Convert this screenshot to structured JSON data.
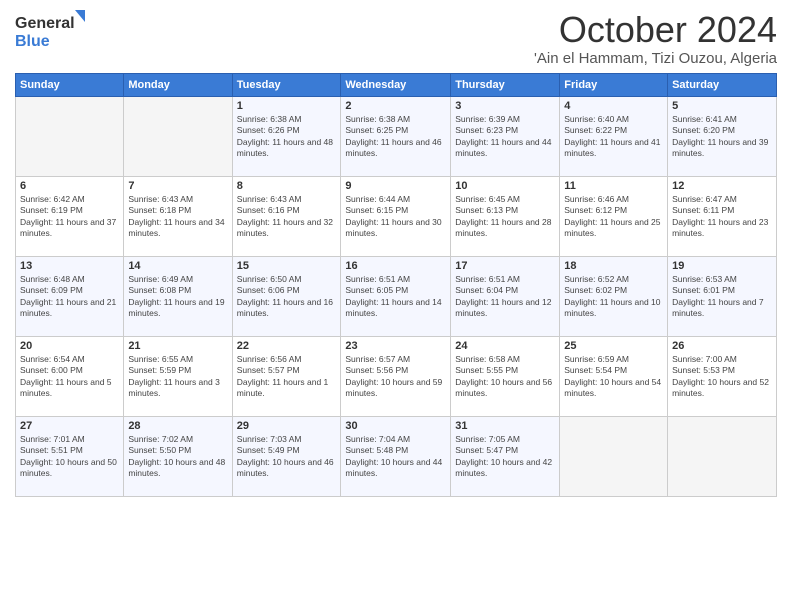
{
  "header": {
    "logo_general": "General",
    "logo_blue": "Blue",
    "title": "October 2024",
    "location": "'Ain el Hammam, Tizi Ouzou, Algeria"
  },
  "weekdays": [
    "Sunday",
    "Monday",
    "Tuesday",
    "Wednesday",
    "Thursday",
    "Friday",
    "Saturday"
  ],
  "weeks": [
    [
      {
        "day": "",
        "sunrise": "",
        "sunset": "",
        "daylight": ""
      },
      {
        "day": "",
        "sunrise": "",
        "sunset": "",
        "daylight": ""
      },
      {
        "day": "1",
        "sunrise": "Sunrise: 6:38 AM",
        "sunset": "Sunset: 6:26 PM",
        "daylight": "Daylight: 11 hours and 48 minutes."
      },
      {
        "day": "2",
        "sunrise": "Sunrise: 6:38 AM",
        "sunset": "Sunset: 6:25 PM",
        "daylight": "Daylight: 11 hours and 46 minutes."
      },
      {
        "day": "3",
        "sunrise": "Sunrise: 6:39 AM",
        "sunset": "Sunset: 6:23 PM",
        "daylight": "Daylight: 11 hours and 44 minutes."
      },
      {
        "day": "4",
        "sunrise": "Sunrise: 6:40 AM",
        "sunset": "Sunset: 6:22 PM",
        "daylight": "Daylight: 11 hours and 41 minutes."
      },
      {
        "day": "5",
        "sunrise": "Sunrise: 6:41 AM",
        "sunset": "Sunset: 6:20 PM",
        "daylight": "Daylight: 11 hours and 39 minutes."
      }
    ],
    [
      {
        "day": "6",
        "sunrise": "Sunrise: 6:42 AM",
        "sunset": "Sunset: 6:19 PM",
        "daylight": "Daylight: 11 hours and 37 minutes."
      },
      {
        "day": "7",
        "sunrise": "Sunrise: 6:43 AM",
        "sunset": "Sunset: 6:18 PM",
        "daylight": "Daylight: 11 hours and 34 minutes."
      },
      {
        "day": "8",
        "sunrise": "Sunrise: 6:43 AM",
        "sunset": "Sunset: 6:16 PM",
        "daylight": "Daylight: 11 hours and 32 minutes."
      },
      {
        "day": "9",
        "sunrise": "Sunrise: 6:44 AM",
        "sunset": "Sunset: 6:15 PM",
        "daylight": "Daylight: 11 hours and 30 minutes."
      },
      {
        "day": "10",
        "sunrise": "Sunrise: 6:45 AM",
        "sunset": "Sunset: 6:13 PM",
        "daylight": "Daylight: 11 hours and 28 minutes."
      },
      {
        "day": "11",
        "sunrise": "Sunrise: 6:46 AM",
        "sunset": "Sunset: 6:12 PM",
        "daylight": "Daylight: 11 hours and 25 minutes."
      },
      {
        "day": "12",
        "sunrise": "Sunrise: 6:47 AM",
        "sunset": "Sunset: 6:11 PM",
        "daylight": "Daylight: 11 hours and 23 minutes."
      }
    ],
    [
      {
        "day": "13",
        "sunrise": "Sunrise: 6:48 AM",
        "sunset": "Sunset: 6:09 PM",
        "daylight": "Daylight: 11 hours and 21 minutes."
      },
      {
        "day": "14",
        "sunrise": "Sunrise: 6:49 AM",
        "sunset": "Sunset: 6:08 PM",
        "daylight": "Daylight: 11 hours and 19 minutes."
      },
      {
        "day": "15",
        "sunrise": "Sunrise: 6:50 AM",
        "sunset": "Sunset: 6:06 PM",
        "daylight": "Daylight: 11 hours and 16 minutes."
      },
      {
        "day": "16",
        "sunrise": "Sunrise: 6:51 AM",
        "sunset": "Sunset: 6:05 PM",
        "daylight": "Daylight: 11 hours and 14 minutes."
      },
      {
        "day": "17",
        "sunrise": "Sunrise: 6:51 AM",
        "sunset": "Sunset: 6:04 PM",
        "daylight": "Daylight: 11 hours and 12 minutes."
      },
      {
        "day": "18",
        "sunrise": "Sunrise: 6:52 AM",
        "sunset": "Sunset: 6:02 PM",
        "daylight": "Daylight: 11 hours and 10 minutes."
      },
      {
        "day": "19",
        "sunrise": "Sunrise: 6:53 AM",
        "sunset": "Sunset: 6:01 PM",
        "daylight": "Daylight: 11 hours and 7 minutes."
      }
    ],
    [
      {
        "day": "20",
        "sunrise": "Sunrise: 6:54 AM",
        "sunset": "Sunset: 6:00 PM",
        "daylight": "Daylight: 11 hours and 5 minutes."
      },
      {
        "day": "21",
        "sunrise": "Sunrise: 6:55 AM",
        "sunset": "Sunset: 5:59 PM",
        "daylight": "Daylight: 11 hours and 3 minutes."
      },
      {
        "day": "22",
        "sunrise": "Sunrise: 6:56 AM",
        "sunset": "Sunset: 5:57 PM",
        "daylight": "Daylight: 11 hours and 1 minute."
      },
      {
        "day": "23",
        "sunrise": "Sunrise: 6:57 AM",
        "sunset": "Sunset: 5:56 PM",
        "daylight": "Daylight: 10 hours and 59 minutes."
      },
      {
        "day": "24",
        "sunrise": "Sunrise: 6:58 AM",
        "sunset": "Sunset: 5:55 PM",
        "daylight": "Daylight: 10 hours and 56 minutes."
      },
      {
        "day": "25",
        "sunrise": "Sunrise: 6:59 AM",
        "sunset": "Sunset: 5:54 PM",
        "daylight": "Daylight: 10 hours and 54 minutes."
      },
      {
        "day": "26",
        "sunrise": "Sunrise: 7:00 AM",
        "sunset": "Sunset: 5:53 PM",
        "daylight": "Daylight: 10 hours and 52 minutes."
      }
    ],
    [
      {
        "day": "27",
        "sunrise": "Sunrise: 7:01 AM",
        "sunset": "Sunset: 5:51 PM",
        "daylight": "Daylight: 10 hours and 50 minutes."
      },
      {
        "day": "28",
        "sunrise": "Sunrise: 7:02 AM",
        "sunset": "Sunset: 5:50 PM",
        "daylight": "Daylight: 10 hours and 48 minutes."
      },
      {
        "day": "29",
        "sunrise": "Sunrise: 7:03 AM",
        "sunset": "Sunset: 5:49 PM",
        "daylight": "Daylight: 10 hours and 46 minutes."
      },
      {
        "day": "30",
        "sunrise": "Sunrise: 7:04 AM",
        "sunset": "Sunset: 5:48 PM",
        "daylight": "Daylight: 10 hours and 44 minutes."
      },
      {
        "day": "31",
        "sunrise": "Sunrise: 7:05 AM",
        "sunset": "Sunset: 5:47 PM",
        "daylight": "Daylight: 10 hours and 42 minutes."
      },
      {
        "day": "",
        "sunrise": "",
        "sunset": "",
        "daylight": ""
      },
      {
        "day": "",
        "sunrise": "",
        "sunset": "",
        "daylight": ""
      }
    ]
  ]
}
